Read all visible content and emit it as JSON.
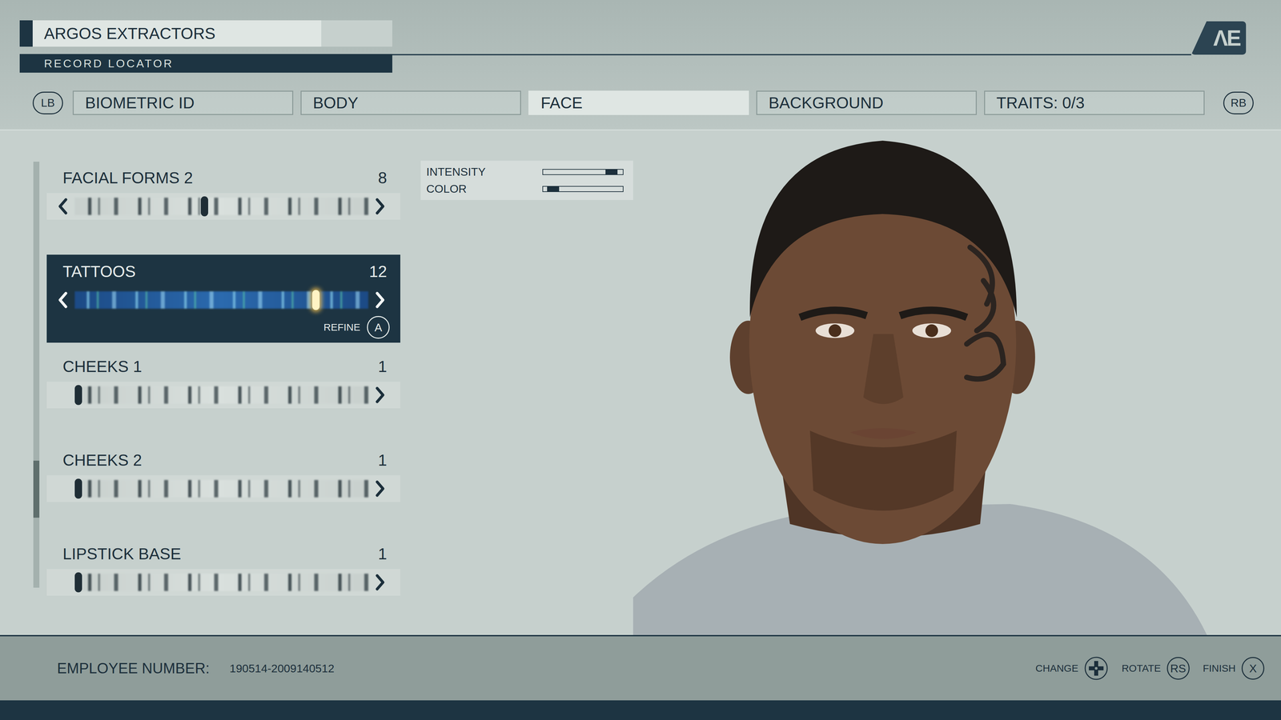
{
  "header": {
    "company": "ARGOS EXTRACTORS",
    "subtitle": "RECORD LOCATOR",
    "logo": "ΛE"
  },
  "nav": {
    "prev": "LB",
    "next": "RB"
  },
  "tabs": [
    {
      "label": "BIOMETRIC ID",
      "selected": false
    },
    {
      "label": "BODY",
      "selected": false
    },
    {
      "label": "FACE",
      "selected": true
    },
    {
      "label": "BACKGROUND",
      "selected": false
    },
    {
      "label": "TRAITS: 0/3",
      "selected": false
    }
  ],
  "sliders": [
    {
      "label": "FACIAL FORMS 2",
      "value": "8",
      "level": 0.44,
      "selected": false,
      "can_decrease": true
    },
    {
      "label": "TATTOOS",
      "value": "12",
      "level": 0.83,
      "selected": true,
      "can_decrease": true
    },
    {
      "label": "CHEEKS 1",
      "value": "1",
      "level": 0,
      "selected": false,
      "can_decrease": false
    },
    {
      "label": "CHEEKS 2",
      "value": "1",
      "level": 0,
      "selected": false,
      "can_decrease": false
    },
    {
      "label": "LIPSTICK BASE",
      "value": "1",
      "level": 0,
      "selected": false,
      "can_decrease": false
    }
  ],
  "refine": {
    "label": "REFINE",
    "key": "A"
  },
  "scroll": {
    "level": 0.81
  },
  "adjustments": [
    {
      "label": "INTENSITY",
      "level": 0.92
    },
    {
      "label": "COLOR",
      "level": 0.06
    }
  ],
  "footer": {
    "employee_label": "EMPLOYEE NUMBER:",
    "employee_number": "190514-2009140512",
    "actions": [
      {
        "label": "CHANGE",
        "kind": "dpad",
        "key": ""
      },
      {
        "label": "ROTATE",
        "kind": "key",
        "key": "RS"
      },
      {
        "label": "FINISH",
        "kind": "key",
        "key": "X"
      }
    ]
  }
}
